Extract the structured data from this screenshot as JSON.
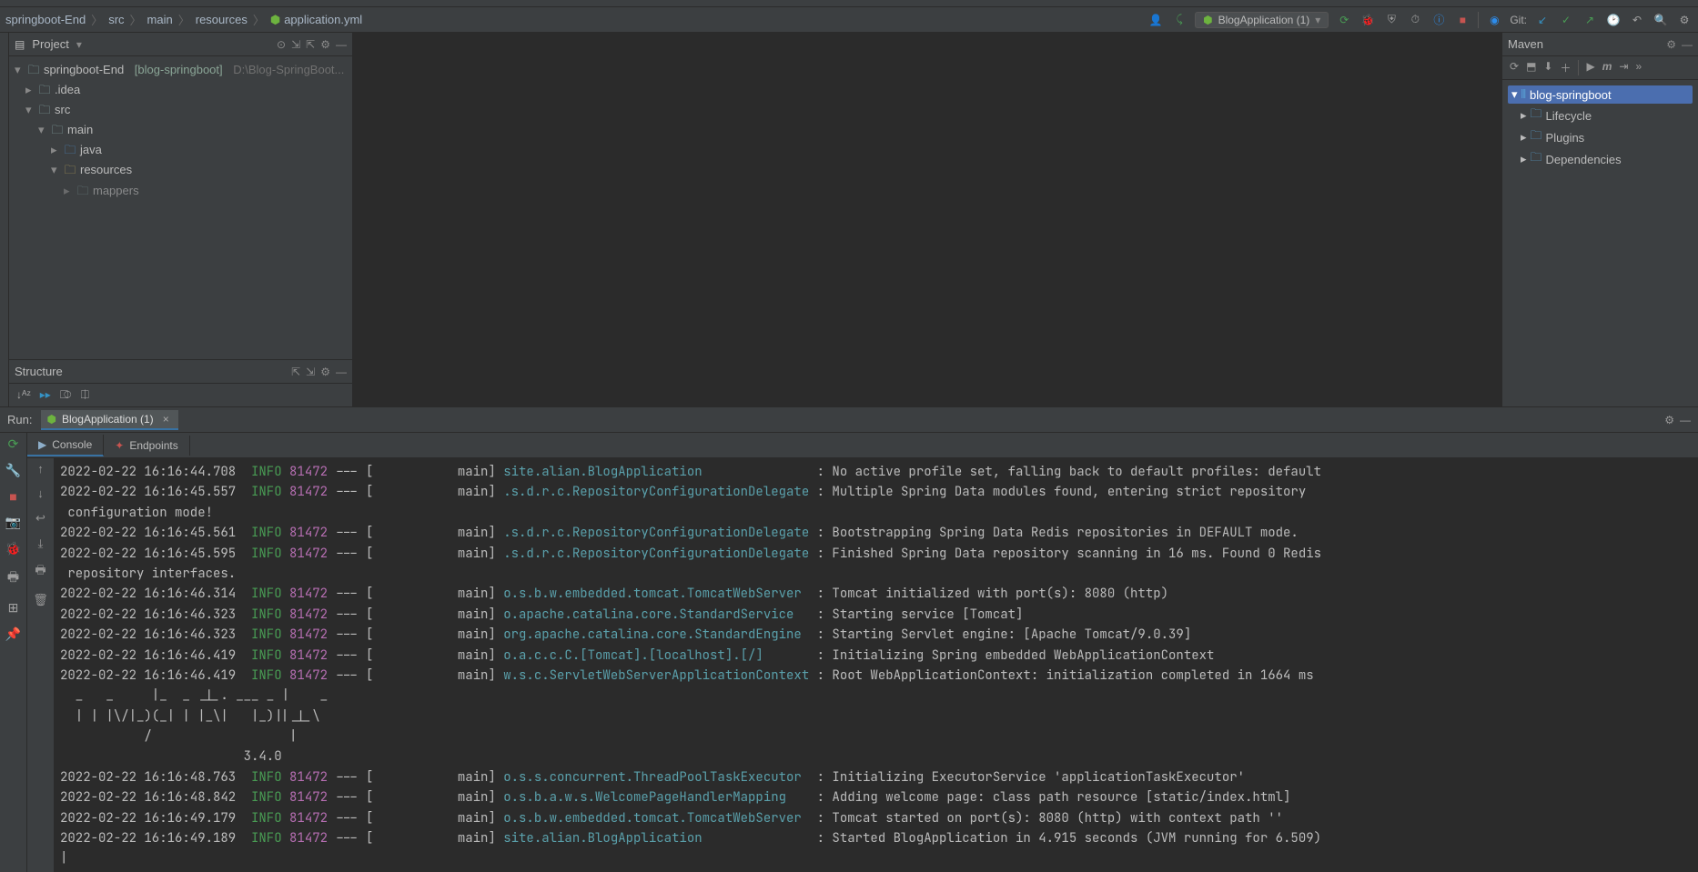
{
  "breadcrumb": {
    "p0": "springboot-End",
    "p1": "src",
    "p2": "main",
    "p3": "resources",
    "p4": "application.yml"
  },
  "run_config": {
    "name": "BlogApplication (1)"
  },
  "git": {
    "label": "Git:"
  },
  "project": {
    "panel_title": "Project",
    "root_name": "springboot-End",
    "root_bracket": "[blog-springboot]",
    "root_path": "D:\\Blog-SpringBoot...",
    "idea": ".idea",
    "src": "src",
    "main": "main",
    "java": "java",
    "resources": "resources",
    "mappers": "mappers"
  },
  "structure": {
    "title": "Structure"
  },
  "maven": {
    "title": "Maven",
    "root": "blog-springboot",
    "lifecycle": "Lifecycle",
    "plugins": "Plugins",
    "dependencies": "Dependencies"
  },
  "run": {
    "label": "Run:",
    "tab": "BlogApplication (1)",
    "console_tab": "Console",
    "endpoints_tab": "Endpoints"
  },
  "console_lines": [
    {
      "ts": "2022-02-22 16:16:44.708",
      "lvl": "INFO",
      "pid": "81472",
      "thread": "main",
      "logger": "site.alian.BlogApplication",
      "msg": "No active profile set, falling back to default profiles: default"
    },
    {
      "ts": "2022-02-22 16:16:45.557",
      "lvl": "INFO",
      "pid": "81472",
      "thread": "main",
      "logger": ".s.d.r.c.RepositoryConfigurationDelegate",
      "msg": "Multiple Spring Data modules found, entering strict repository"
    },
    {
      "cont": "configuration mode!"
    },
    {
      "ts": "2022-02-22 16:16:45.561",
      "lvl": "INFO",
      "pid": "81472",
      "thread": "main",
      "logger": ".s.d.r.c.RepositoryConfigurationDelegate",
      "msg": "Bootstrapping Spring Data Redis repositories in DEFAULT mode."
    },
    {
      "ts": "2022-02-22 16:16:45.595",
      "lvl": "INFO",
      "pid": "81472",
      "thread": "main",
      "logger": ".s.d.r.c.RepositoryConfigurationDelegate",
      "msg": "Finished Spring Data repository scanning in 16 ms. Found 0 Redis"
    },
    {
      "cont": "repository interfaces."
    },
    {
      "ts": "2022-02-22 16:16:46.314",
      "lvl": "INFO",
      "pid": "81472",
      "thread": "main",
      "logger": "o.s.b.w.embedded.tomcat.TomcatWebServer",
      "msg": "Tomcat initialized with port(s): 8080 (http)"
    },
    {
      "ts": "2022-02-22 16:16:46.323",
      "lvl": "INFO",
      "pid": "81472",
      "thread": "main",
      "logger": "o.apache.catalina.core.StandardService",
      "msg": "Starting service [Tomcat]"
    },
    {
      "ts": "2022-02-22 16:16:46.323",
      "lvl": "INFO",
      "pid": "81472",
      "thread": "main",
      "logger": "org.apache.catalina.core.StandardEngine",
      "msg": "Starting Servlet engine: [Apache Tomcat/9.0.39]"
    },
    {
      "ts": "2022-02-22 16:16:46.419",
      "lvl": "INFO",
      "pid": "81472",
      "thread": "main",
      "logger": "o.a.c.c.C.[Tomcat].[localhost].[/]",
      "msg": "Initializing Spring embedded WebApplicationContext"
    },
    {
      "ts": "2022-02-22 16:16:46.419",
      "lvl": "INFO",
      "pid": "81472",
      "thread": "main",
      "logger": "w.s.c.ServletWebServerApplicationContext",
      "msg": "Root WebApplicationContext: initialization completed in 1664 ms"
    },
    {
      "raw": "  _   _     |_  _ _|_. ___ _ |    _ "
    },
    {
      "raw": "  | | |\\/|_)(_| | |_\\|   |_)||_|_\\"
    },
    {
      "raw": "           /                  |"
    },
    {
      "raw": "                        3.4.0 "
    },
    {
      "ts": "2022-02-22 16:16:48.763",
      "lvl": "INFO",
      "pid": "81472",
      "thread": "main",
      "logger": "o.s.s.concurrent.ThreadPoolTaskExecutor",
      "msg": "Initializing ExecutorService 'applicationTaskExecutor'"
    },
    {
      "ts": "2022-02-22 16:16:48.842",
      "lvl": "INFO",
      "pid": "81472",
      "thread": "main",
      "logger": "o.s.b.a.w.s.WelcomePageHandlerMapping",
      "msg": "Adding welcome page: class path resource [static/index.html]"
    },
    {
      "ts": "2022-02-22 16:16:49.179",
      "lvl": "INFO",
      "pid": "81472",
      "thread": "main",
      "logger": "o.s.b.w.embedded.tomcat.TomcatWebServer",
      "msg": "Tomcat started on port(s): 8080 (http) with context path ''"
    },
    {
      "ts": "2022-02-22 16:16:49.189",
      "lvl": "INFO",
      "pid": "81472",
      "thread": "main",
      "logger": "site.alian.BlogApplication",
      "msg": "Started BlogApplication in 4.915 seconds (JVM running for 6.509)"
    }
  ]
}
